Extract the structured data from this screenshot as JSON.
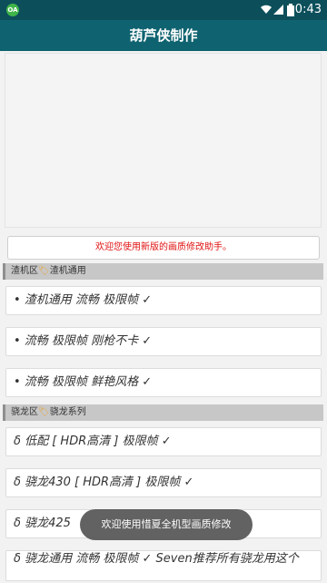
{
  "status_bar": {
    "app_icon_text": "OA",
    "time": "10:43"
  },
  "app_bar": {
    "title": "葫芦侠制作"
  },
  "welcome_text": "欢迎您使用新版的画质修改助手。",
  "sections": [
    {
      "prefix": "渣机区",
      "name": "渣机通用",
      "items": [
        "• 渣机通用  流畅  极限帧    ✓",
        "• 流畅  极限帧  刚枪不卡    ✓",
        "• 流畅  极限帧  鲜艳风格    ✓"
      ]
    },
    {
      "prefix": "骁龙区",
      "name": "骁龙系列",
      "items": [
        "δ  低配   [ HDR高清 ]   极限帧    ✓",
        "δ  骁龙430   [ HDR高清 ]   极限帧   ✓",
        "δ  骁龙425",
        "δ  骁龙通用  流畅  极限帧   ✓    Seven推荐所有骁龙用这个"
      ]
    }
  ],
  "toast": "欢迎使用惜夏全机型画质修改"
}
